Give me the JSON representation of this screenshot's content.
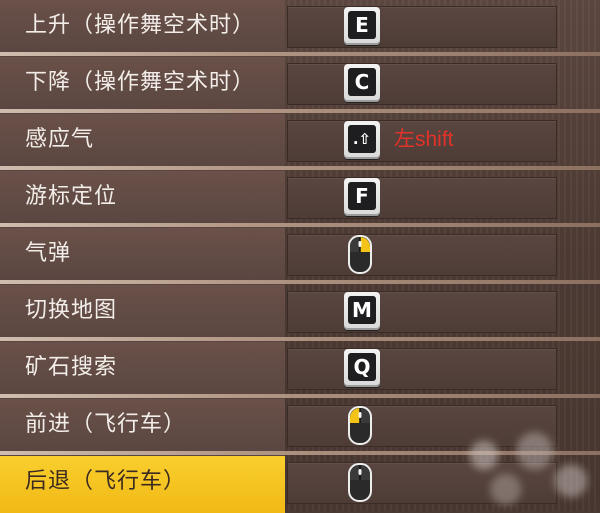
{
  "rows": [
    {
      "label": "上升（操作舞空术时）",
      "key": "E",
      "key_type": "letter",
      "note": ""
    },
    {
      "label": "下降（操作舞空术时）",
      "key": "C",
      "key_type": "letter",
      "note": ""
    },
    {
      "label": "感应气",
      "key": ".⇧",
      "key_type": "shift",
      "note": "左shift"
    },
    {
      "label": "游标定位",
      "key": "F",
      "key_type": "letter",
      "note": ""
    },
    {
      "label": "气弹",
      "key": "",
      "key_type": "mouse-left-icon",
      "note": ""
    },
    {
      "label": "切换地图",
      "key": "M",
      "key_type": "letter",
      "note": ""
    },
    {
      "label": "矿石搜索",
      "key": "Q",
      "key_type": "letter",
      "note": ""
    },
    {
      "label": "前进（飞行车）",
      "key": "",
      "key_type": "mouse-left-icon",
      "note": ""
    },
    {
      "label": "后退（飞行车）",
      "key": "",
      "key_type": "mouse-right-icon",
      "note": "",
      "highlighted": true
    }
  ],
  "colors": {
    "highlight": "#f5c420",
    "note_text": "#e2322a",
    "mouse_button": "#f3c417"
  }
}
